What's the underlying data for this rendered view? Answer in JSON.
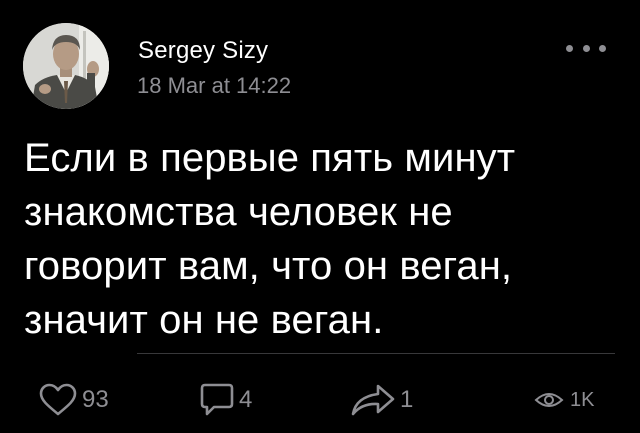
{
  "post": {
    "author": "Sergey Sizy",
    "timestamp": "18 Mar at 14:22",
    "text": "Если в первые пять минут\nзнакомства человек не\nговорит вам, что он веган,\nзначит он не веган."
  },
  "actions": {
    "likes": "93",
    "comments": "4",
    "shares": "1",
    "views": "1K"
  },
  "icons": {
    "like": "heart-icon",
    "comment": "comment-bubble-icon",
    "share": "share-arrow-icon",
    "views": "eye-icon",
    "more": "more-dots-icon"
  },
  "colors": {
    "background": "#000000",
    "text": "#ffffff",
    "secondary": "#8e8e93",
    "divider": "#38383a"
  }
}
